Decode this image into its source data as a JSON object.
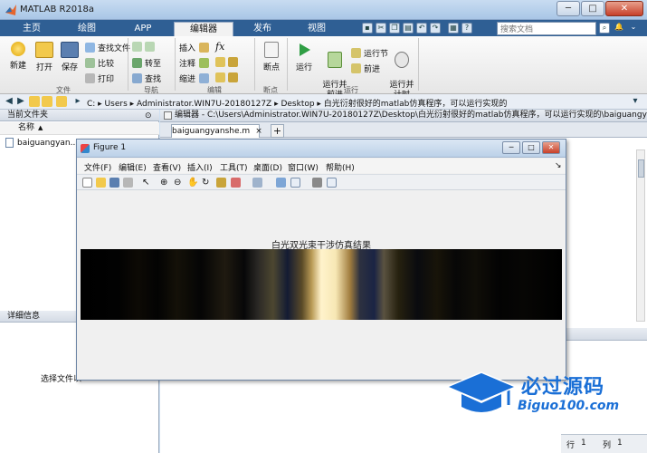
{
  "window": {
    "title": "MATLAB R2018a",
    "min": "─",
    "max": "□",
    "close": "✕"
  },
  "tabs": [
    "主页",
    "绘图",
    "APP",
    "编辑器",
    "发布",
    "视图"
  ],
  "search": {
    "placeholder": "搜索文档"
  },
  "ribbon": {
    "file_group": {
      "new": "新建",
      "open": "打开",
      "save": "保存",
      "find_files": "查找文件",
      "compare": "比较",
      "print": "打印",
      "label": "文件"
    },
    "nav_group": {
      "goto": "转至",
      "find": "查找",
      "label": "导航"
    },
    "edit_group": {
      "insert": "插入",
      "comment": "注释",
      "indent": "缩进",
      "fx": "fx",
      "label": "编辑"
    },
    "breakpoint_group": {
      "breakpoint": "断点",
      "label": "断点"
    },
    "run_group": {
      "run": "运行",
      "run_advance": "运行并\n前进",
      "run_section": "运行节",
      "advance": "前进",
      "run_time": "运行并\n计时",
      "label": "运行"
    }
  },
  "address": {
    "path": "C: ▸ Users ▸ Administrator.WIN7U-20180127Z ▸ Desktop ▸ 白光衍射很好的matlab仿真程序，可以运行实现的"
  },
  "left_pane": {
    "header": "当前文件夹",
    "column": "名称",
    "sort_indicator": "▲",
    "file": "baiguangyan...",
    "detail_header": "详细信息",
    "detail_text": "选择文件以"
  },
  "editor": {
    "header": "编辑器 - C:\\Users\\Administrator.WIN7U-20180127Z\\Desktop\\白光衍射很好的matlab仿真程序，可以运行实现的\\baiguangyan...",
    "tab": "baiguangyanshe.m",
    "close_tab": "×",
    "new_tab": "+"
  },
  "figure": {
    "title": "Figure 1",
    "menus": [
      "文件(F)",
      "编辑(E)",
      "查看(V)",
      "插入(I)",
      "工具(T)",
      "桌面(D)",
      "窗口(W)",
      "帮助(H)"
    ],
    "plot_title": "白光双光束干涉仿真结果",
    "fringe_image": "white-light interference fringe pattern"
  },
  "status": {
    "row_label": "行",
    "row": "1",
    "col_label": "列",
    "col": "1"
  },
  "watermark": {
    "text": "必过源码",
    "sub": "Biguo100.com"
  },
  "colors": {
    "accent": "#2f5f94",
    "brand_blue": "#1a6fd6"
  }
}
